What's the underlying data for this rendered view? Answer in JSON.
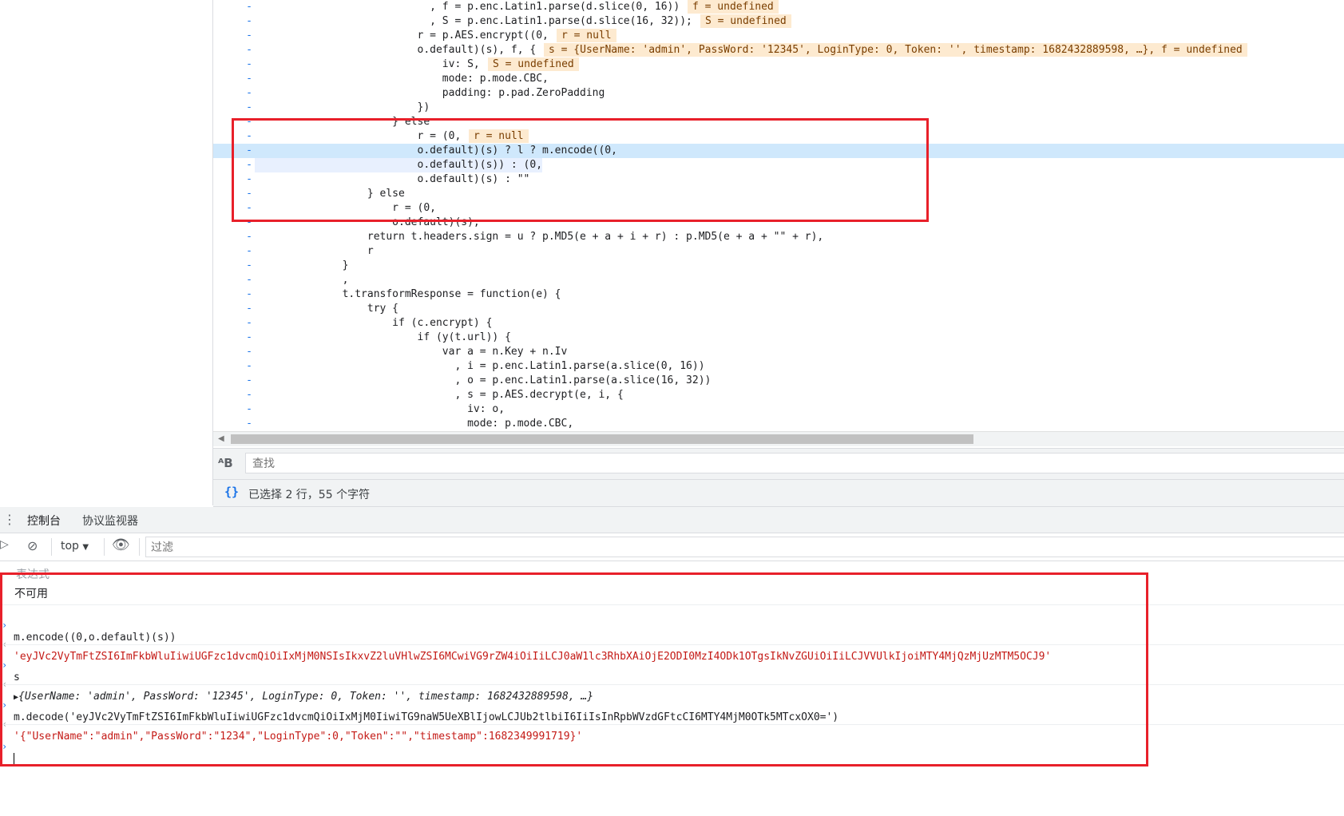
{
  "code_lines": [
    {
      "gutter": "-",
      "text": "                            , f = p.enc.Latin1.parse(d.slice(0, 16))",
      "inline": "f = undefined"
    },
    {
      "gutter": "-",
      "text": "                            , S = p.enc.Latin1.parse(d.slice(16, 32));",
      "inline": "S = undefined"
    },
    {
      "gutter": "-",
      "text": "                          r = p.AES.encrypt((0,",
      "inline": "r = null"
    },
    {
      "gutter": "-",
      "text": "                          o.default)(s), f, {",
      "inline": "s = {UserName: 'admin', PassWord: '12345', LoginType: 0, Token: '', timestamp: 1682432889598, …}, f = undefined"
    },
    {
      "gutter": "-",
      "text": "                              iv: S,",
      "inline": "S = undefined"
    },
    {
      "gutter": "-",
      "text": "                              mode: p.mode.CBC,",
      "inline": ""
    },
    {
      "gutter": "-",
      "text": "                              padding: p.pad.ZeroPadding",
      "inline": ""
    },
    {
      "gutter": "-",
      "text": "                          })",
      "inline": ""
    },
    {
      "gutter": "-",
      "text": "                      } else",
      "inline": ""
    },
    {
      "gutter": "-",
      "text": "                          r = (0,",
      "inline": "r = null"
    },
    {
      "gutter": "-",
      "text": "                          o.default)(s) ? l ? m.encode((0,",
      "inline": ""
    },
    {
      "gutter": "-",
      "text": "                          o.default)(s)) : (0,",
      "inline": ""
    },
    {
      "gutter": "-",
      "text": "                          o.default)(s) : \"\"",
      "inline": ""
    },
    {
      "gutter": "-",
      "text": "                  } else",
      "inline": ""
    },
    {
      "gutter": "-",
      "text": "                      r = (0,",
      "inline": ""
    },
    {
      "gutter": "-",
      "text": "                      o.default)(s);",
      "inline": ""
    },
    {
      "gutter": "-",
      "text": "                  return t.headers.sign = u ? p.MD5(e + a + i + r) : p.MD5(e + a + \"\" + r),",
      "inline": ""
    },
    {
      "gutter": "-",
      "text": "                  r",
      "inline": ""
    },
    {
      "gutter": "-",
      "text": "              }",
      "inline": ""
    },
    {
      "gutter": "-",
      "text": "              ,",
      "inline": ""
    },
    {
      "gutter": "-",
      "text": "              t.transformResponse = function(e) {",
      "inline": ""
    },
    {
      "gutter": "-",
      "text": "                  try {",
      "inline": ""
    },
    {
      "gutter": "-",
      "text": "                      if (c.encrypt) {",
      "inline": ""
    },
    {
      "gutter": "-",
      "text": "                          if (y(t.url)) {",
      "inline": ""
    },
    {
      "gutter": "-",
      "text": "                              var a = n.Key + n.Iv",
      "inline": ""
    },
    {
      "gutter": "-",
      "text": "                                , i = p.enc.Latin1.parse(a.slice(0, 16))",
      "inline": ""
    },
    {
      "gutter": "-",
      "text": "                                , o = p.enc.Latin1.parse(a.slice(16, 32))",
      "inline": ""
    },
    {
      "gutter": "-",
      "text": "                                , s = p.AES.decrypt(e, i, {",
      "inline": ""
    },
    {
      "gutter": "-",
      "text": "                                  iv: o,",
      "inline": ""
    },
    {
      "gutter": "-",
      "text": "                                  mode: p.mode.CBC,",
      "inline": ""
    }
  ],
  "search": {
    "placeholder": "查找",
    "icon": "match-case-icon"
  },
  "status": {
    "text": "已选择 2 行，55 个字符",
    "icon": "pretty-print-braces-icon"
  },
  "drawer": {
    "tabs": [
      {
        "label": "控制台"
      },
      {
        "label": "协议监视器"
      }
    ]
  },
  "console_toolbar": {
    "context": "top",
    "filter_placeholder": "过滤"
  },
  "console": {
    "expression_header": "表达式",
    "expression_value": "不可用",
    "entries": [
      {
        "kind": "input",
        "text": "m.encode((0,o.default)(s))"
      },
      {
        "kind": "output",
        "text": "'eyJVc2VyTmFtZSI6ImFkbWluIiwiUGFzc1dvcmQiOiIxMjM0NSIsIkxvZ2luVHlwZSI6MCwiVG9rZW4iOiIiLCJ0aW1lc3RhbXAiOjE2ODI0MzI4ODk1OTgsIkNvZGUiOiIiLCJVVUlkIjoiMTY4MjQzMjUzMTM5OCJ9'"
      },
      {
        "kind": "input",
        "text": "s"
      },
      {
        "kind": "object",
        "text": "{UserName: 'admin', PassWord: '12345', LoginType: 0, Token: '', timestamp: 1682432889598, …}"
      },
      {
        "kind": "input",
        "text": "m.decode('eyJVc2VyTmFtZSI6ImFkbWluIiwiUGFzc1dvcmQiOiIxMjM0IiwiTG9naW5UeXBlIjowLCJUb2tlbiI6IiIsInRpbWVzdGFtcCI6MTY4MjM0OTk5MTcxOX0=')"
      },
      {
        "kind": "output",
        "text": "'{\"UserName\":\"admin\",\"PassWord\":\"1234\",\"LoginType\":0,\"Token\":\"\",\"timestamp\":1682349991719}'"
      }
    ]
  },
  "colors": {
    "accent": "#1a73e8",
    "highlight_box": "#e8202a",
    "string": "#c41a16",
    "keyword": "#aa0d91",
    "number": "#1c00cf"
  }
}
